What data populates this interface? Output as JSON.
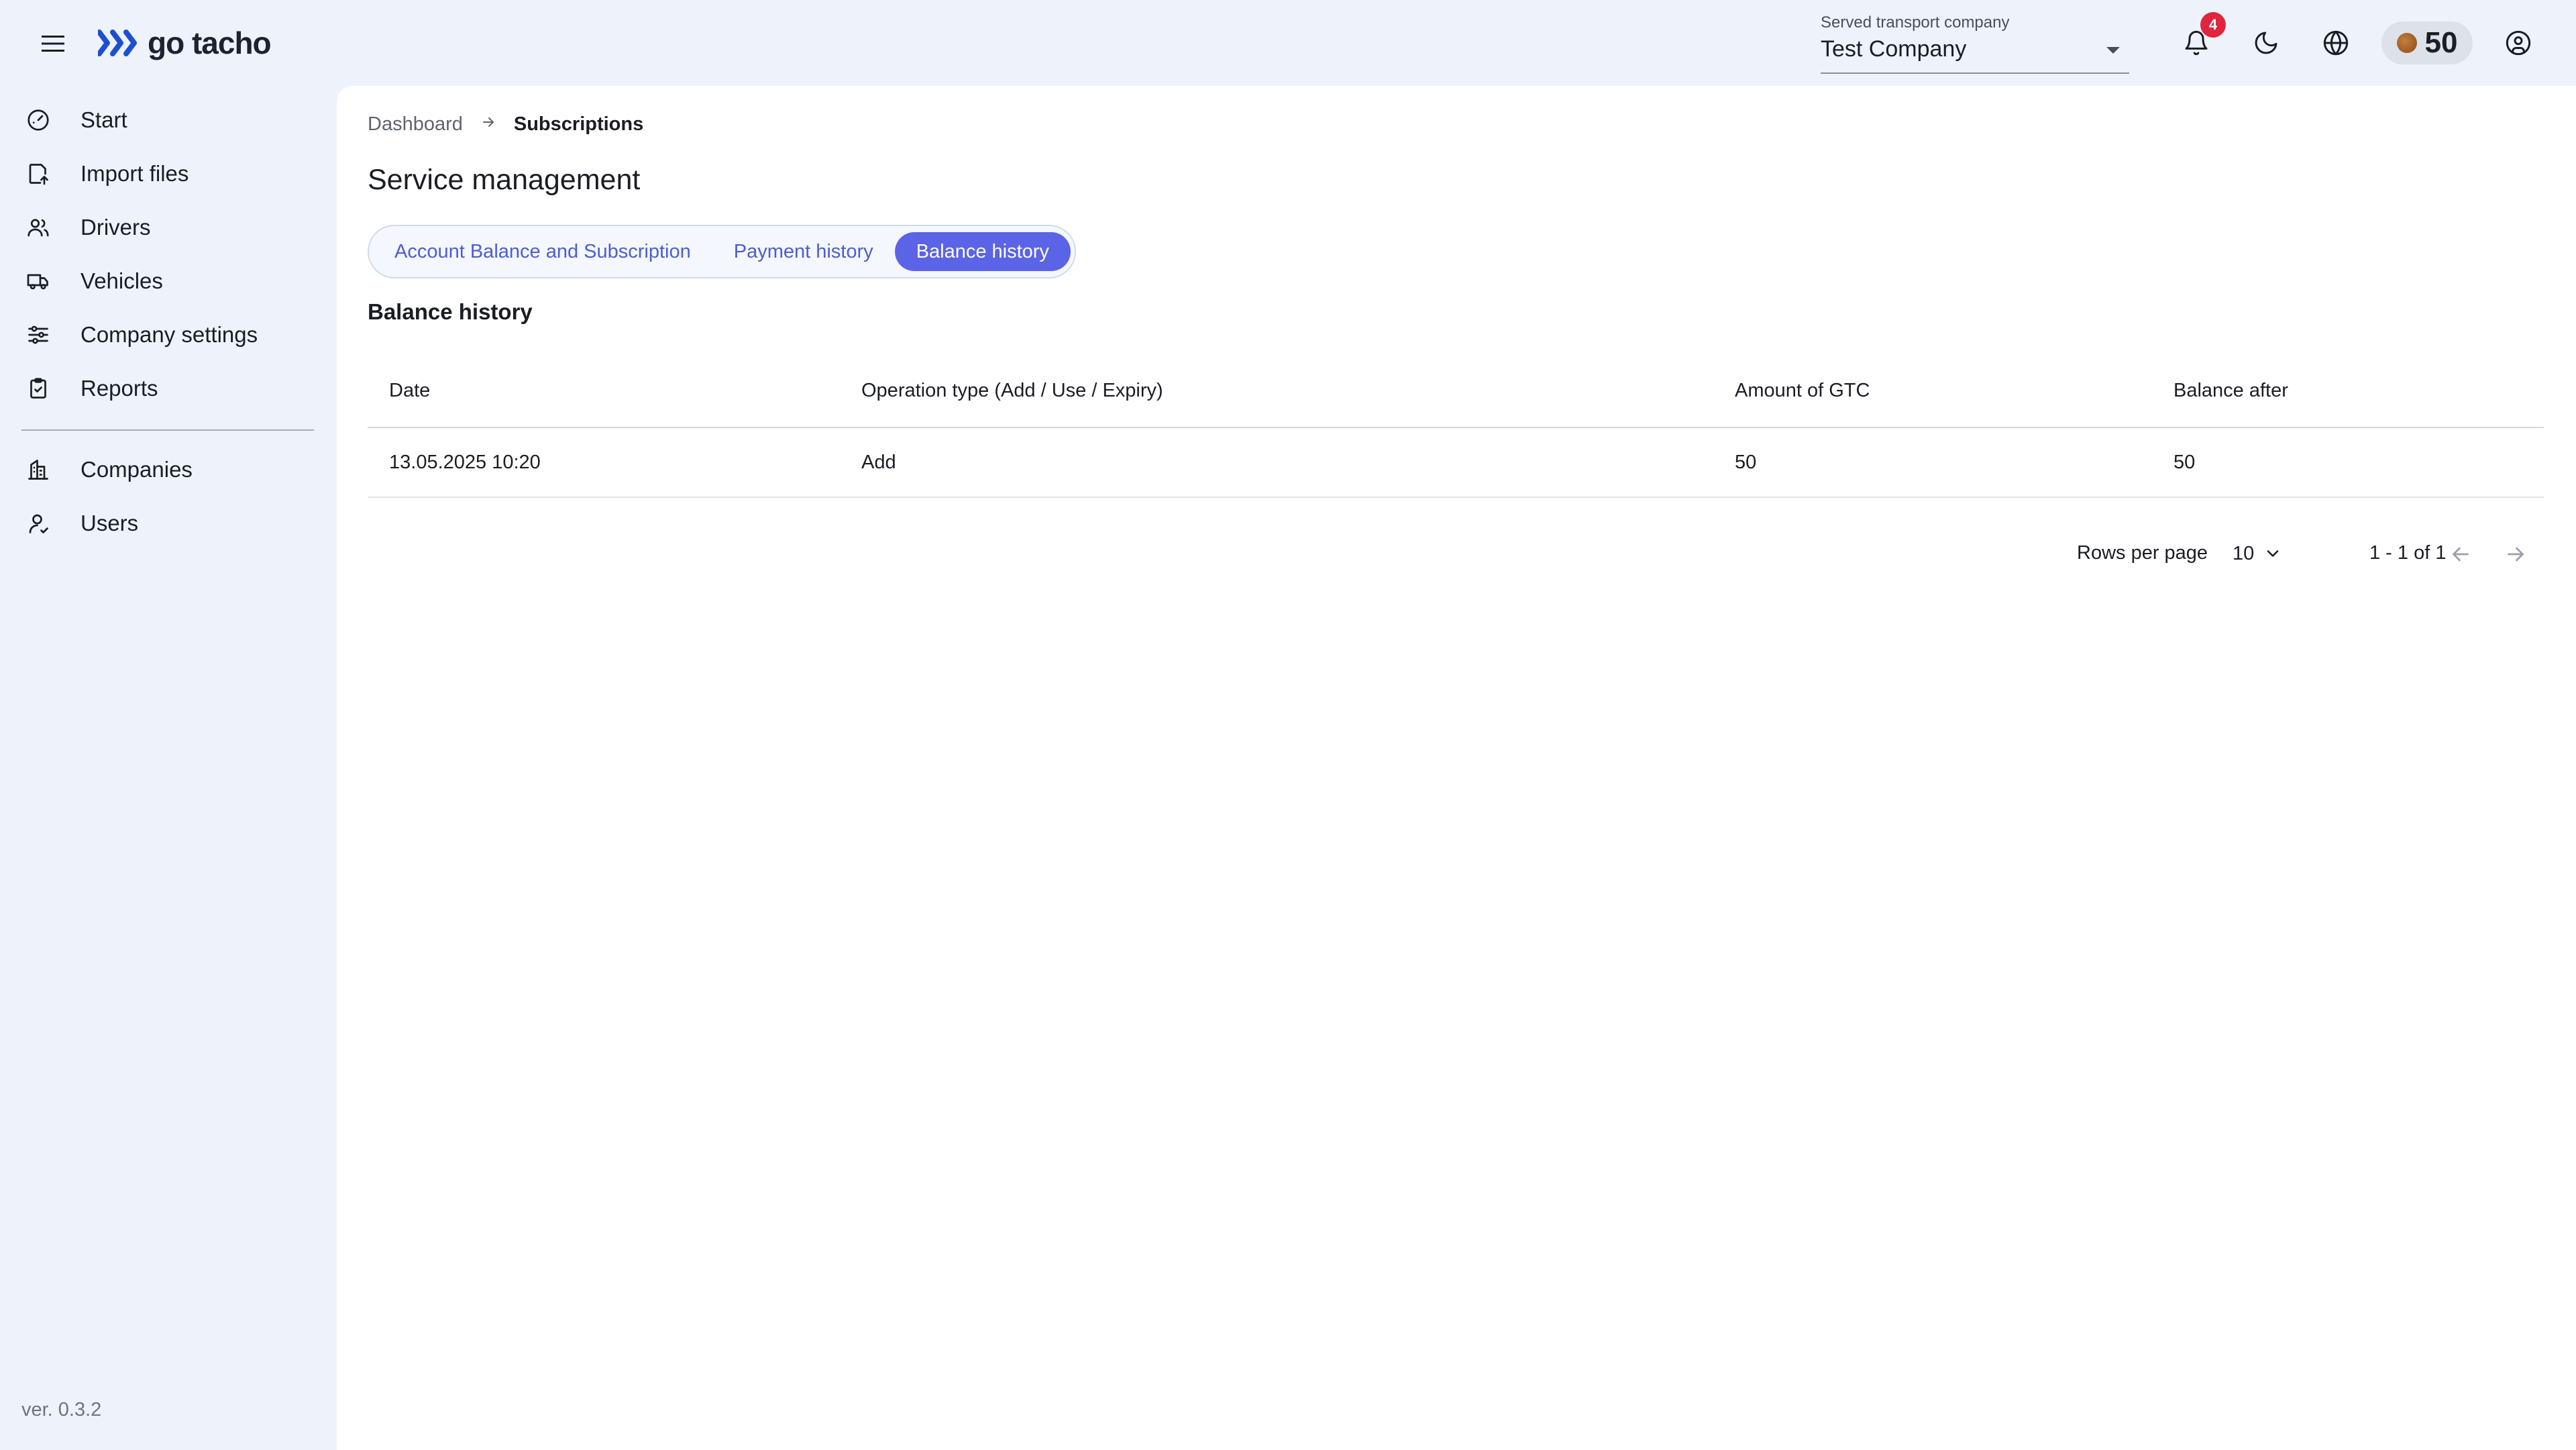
{
  "header": {
    "logo_text": "go tacho",
    "company_select": {
      "label": "Served transport company",
      "value": "Test Company"
    },
    "notification_count": "4",
    "balance": "50"
  },
  "sidebar": {
    "items": [
      {
        "label": "Start",
        "icon": "gauge-icon"
      },
      {
        "label": "Import files",
        "icon": "file-upload-icon"
      },
      {
        "label": "Drivers",
        "icon": "users-icon"
      },
      {
        "label": "Vehicles",
        "icon": "truck-icon"
      },
      {
        "label": "Company settings",
        "icon": "sliders-icon"
      },
      {
        "label": "Reports",
        "icon": "clipboard-icon"
      }
    ],
    "admin_items": [
      {
        "label": "Companies",
        "icon": "building-icon"
      },
      {
        "label": "Users",
        "icon": "user-icon"
      }
    ],
    "version": "ver. 0.3.2"
  },
  "breadcrumb": {
    "parent": "Dashboard",
    "current": "Subscriptions"
  },
  "page_title": "Service management",
  "tabs": [
    {
      "label": "Account Balance and Subscription",
      "active": false
    },
    {
      "label": "Payment history",
      "active": false
    },
    {
      "label": "Balance history",
      "active": true
    }
  ],
  "section_title": "Balance history",
  "table": {
    "columns": [
      "Date",
      "Operation type (Add / Use / Expiry)",
      "Amount of GTC",
      "Balance after"
    ],
    "rows": [
      [
        "13.05.2025 10:20",
        "Add",
        "50",
        "50"
      ]
    ]
  },
  "pagination": {
    "rows_per_page_label": "Rows per page",
    "rows_per_page": "10",
    "range": "1 - 1 of 1"
  },
  "colors": {
    "accent": "#5b63e6",
    "badge": "#e0253d",
    "background": "#eef3fb"
  }
}
